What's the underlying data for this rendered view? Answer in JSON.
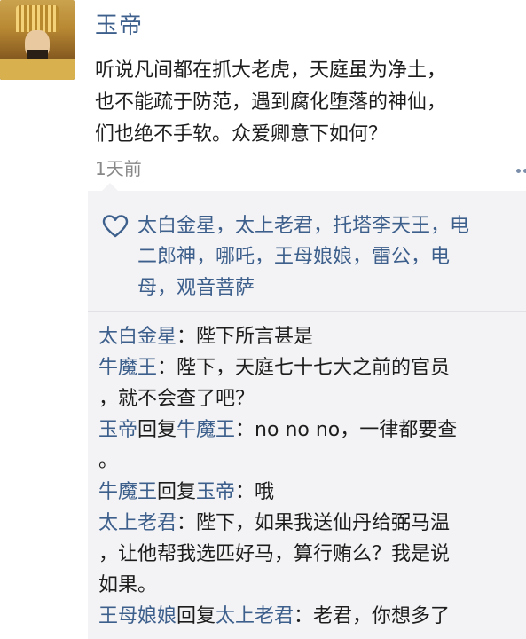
{
  "post": {
    "author": "玉帝",
    "content_lines": [
      "听说凡间都在抓大老虎，天庭虽为净土，",
      "也不能疏于防范，遇到腐化堕落的神仙，",
      "们也绝不手软。众爱卿意下如何？"
    ],
    "time": "1天前"
  },
  "likes": {
    "icon": "heart-outline-icon",
    "lines": [
      "太白金星，太上老君，托塔李天王，电",
      "二郎神，哪吒，王母娘娘，雷公，电",
      "母，观音菩萨"
    ]
  },
  "comments": [
    {
      "author": "太白金星",
      "reply_word": "",
      "reply_to": "",
      "text": "：陛下所言甚是"
    },
    {
      "author": "牛魔王",
      "reply_word": "",
      "reply_to": "",
      "text": "：陛下，天庭七十七大之前的官员"
    },
    {
      "author": "",
      "reply_word": "",
      "reply_to": "",
      "text": "，就不会查了吧？"
    },
    {
      "author": "玉帝",
      "reply_word": "回复",
      "reply_to": "牛魔王",
      "text": "：no no no，一律都要查"
    },
    {
      "author": "",
      "reply_word": "",
      "reply_to": "",
      "text": "。"
    },
    {
      "author": "牛魔王",
      "reply_word": "回复",
      "reply_to": "玉帝",
      "text": "：哦"
    },
    {
      "author": "太上老君",
      "reply_word": "",
      "reply_to": "",
      "text": "：陛下，如果我送仙丹给弼马温"
    },
    {
      "author": "",
      "reply_word": "",
      "reply_to": "",
      "text": "，让他帮我选匹好马，算行贿么？我是说"
    },
    {
      "author": "",
      "reply_word": "",
      "reply_to": "",
      "text": "如果。"
    },
    {
      "author": "王母娘娘",
      "reply_word": "回复",
      "reply_to": "太上老君",
      "text": "：老君，你想多了"
    }
  ],
  "colors": {
    "link": "#3d5f8c",
    "panel": "#f3f3f5",
    "time": "#888888"
  }
}
